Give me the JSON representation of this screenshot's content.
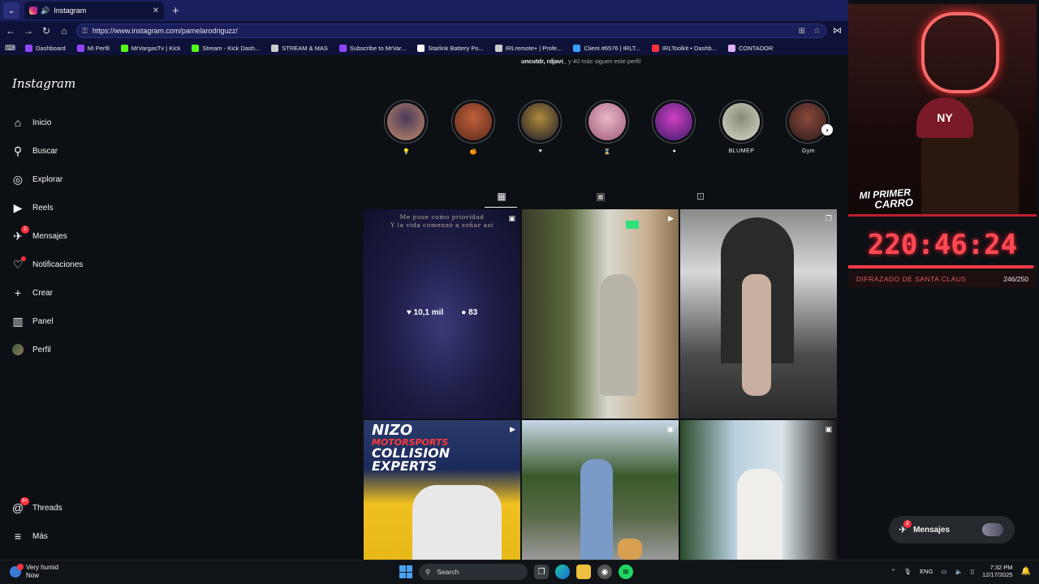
{
  "browser": {
    "tab_title": "Instagram",
    "url": "https://www.instagram.com/pamelarodriguzz/",
    "bookmarks": [
      {
        "label": "Dashboard",
        "color": "#9146ff"
      },
      {
        "label": "Mi Perfil",
        "color": "#9146ff"
      },
      {
        "label": "MrVargasTv | Kick",
        "color": "#53fc18"
      },
      {
        "label": "Stream - Kick Dash...",
        "color": "#53fc18"
      },
      {
        "label": "STREAM & MAS",
        "color": "#cccccc"
      },
      {
        "label": "Subscribe to MrVar...",
        "color": "#9146ff"
      },
      {
        "label": "Starlink Battery Po...",
        "color": "#ffffff"
      },
      {
        "label": "IRLremote+ | Profe...",
        "color": "#cccccc"
      },
      {
        "label": "Client #6576 | IRLT...",
        "color": "#3aa0ff"
      },
      {
        "label": "IRLToolkit • Dashb...",
        "color": "#ff3040"
      },
      {
        "label": "CONTADOR",
        "color": "#e0b0ff"
      }
    ]
  },
  "instagram": {
    "logo": "Instagram",
    "nav": [
      {
        "label": "Inicio",
        "icon": "home-icon",
        "glyph": "⌂"
      },
      {
        "label": "Buscar",
        "icon": "search-icon",
        "glyph": "⚲"
      },
      {
        "label": "Explorar",
        "icon": "compass-icon",
        "glyph": "◎"
      },
      {
        "label": "Reels",
        "icon": "reels-icon",
        "glyph": "▶"
      },
      {
        "label": "Mensajes",
        "icon": "messenger-icon",
        "glyph": "✈",
        "badge": "2"
      },
      {
        "label": "Notificaciones",
        "icon": "heart-icon",
        "glyph": "♡",
        "dot": true
      },
      {
        "label": "Crear",
        "icon": "plus-icon",
        "glyph": "+"
      },
      {
        "label": "Panel",
        "icon": "dashboard-icon",
        "glyph": "▥"
      },
      {
        "label": "Perfil",
        "icon": "profile-avatar",
        "glyph": ""
      }
    ],
    "bottom_nav": [
      {
        "label": "Threads",
        "icon": "threads-icon",
        "glyph": "@",
        "badge": "9+"
      },
      {
        "label": "Más",
        "icon": "menu-icon",
        "glyph": "≡"
      }
    ],
    "followed_by": {
      "users": "uncutdr, rdjavi_",
      "rest": " y 40 más siguen este perfil"
    },
    "highlights": [
      {
        "label": "💡",
        "c1": "#c08a6a",
        "c2": "#4a3a5a"
      },
      {
        "label": "🍊",
        "c1": "#5a2a1a",
        "c2": "#c0603a"
      },
      {
        "label": "♥",
        "c1": "#1a1a2a",
        "c2": "#b08a3a"
      },
      {
        "label": "⌛",
        "c1": "#a05a7a",
        "c2": "#e8b8c8"
      },
      {
        "label": "●",
        "c1": "#3a1a6a",
        "c2": "#d040c0"
      },
      {
        "label": "BLUMEP",
        "c1": "#d8d8c8",
        "c2": "#8a8a7a"
      },
      {
        "label": "Gym",
        "c1": "#2a1a1a",
        "c2": "#8a4a3a"
      }
    ],
    "post1": {
      "line1": "Me puse como prioridad",
      "line2": "Y la vida comenzó a soñar así",
      "likes": "10,1 mil",
      "comments": "83"
    },
    "post4_text": {
      "l1": "NIZO",
      "l2": "MOTORSPORTS",
      "l3": "COLLISION",
      "l4": "EXPERTS"
    }
  },
  "stream": {
    "overlay_l1": "MI PRIMER",
    "overlay_l2": "CARRO",
    "cap_logo": "NY",
    "timer": "220:46:24",
    "goal_name": "DIFRAZADO DE SANTA CLAUS",
    "goal_count": "246/250",
    "goal_fraction": 0.984
  },
  "messages_pill": {
    "label": "Mensajes",
    "badge": "2"
  },
  "taskbar": {
    "weather_line1": "Very humid",
    "weather_line2": "Now",
    "search": "Search",
    "lang": "ENG",
    "time": "7:32 PM",
    "date": "12/17/2025"
  }
}
